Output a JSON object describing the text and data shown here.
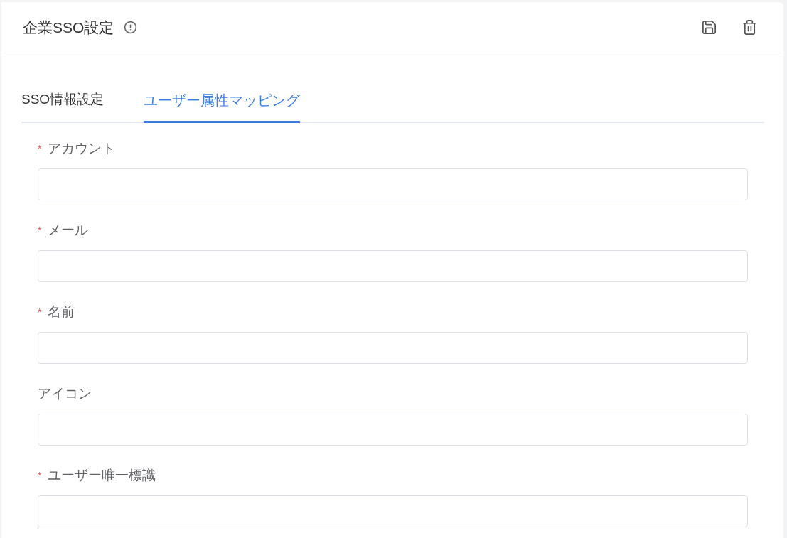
{
  "header": {
    "title": "企業SSO設定"
  },
  "tabs": [
    {
      "label": "SSO情報設定",
      "selected": false
    },
    {
      "label": "ユーザー属性マッピング",
      "selected": true
    }
  ],
  "required_mark": "*",
  "fields": [
    {
      "label": "アカウント",
      "required": true
    },
    {
      "label": "メール",
      "required": true
    },
    {
      "label": "名前",
      "required": true
    },
    {
      "label": "アイコン",
      "required": false
    },
    {
      "label": "ユーザー唯一標識",
      "required": true
    }
  ]
}
